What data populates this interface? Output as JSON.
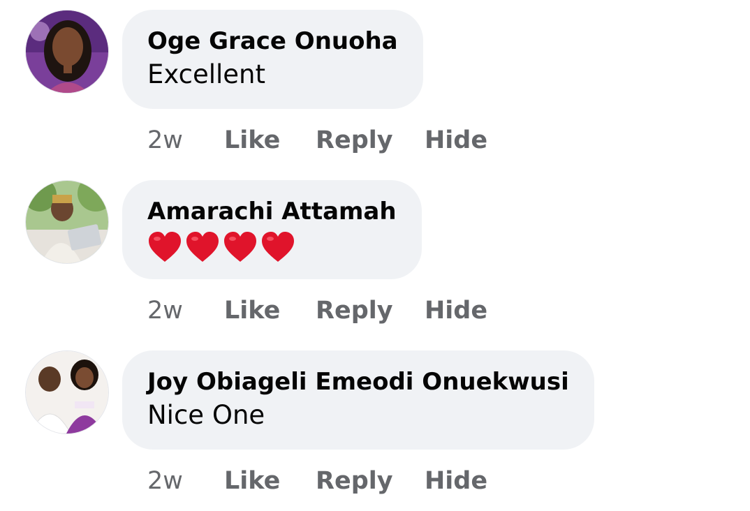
{
  "comments": [
    {
      "author": "Oge Grace Onuoha",
      "text": "Excellent",
      "time": "2w",
      "actions": [
        "Like",
        "Reply",
        "Hide"
      ]
    },
    {
      "author": "Amarachi Attamah",
      "text": "❤️❤️❤️❤️",
      "time": "2w",
      "actions": [
        "Like",
        "Reply",
        "Hide"
      ]
    },
    {
      "author": "Joy Obiageli Emeodi Onuekwusi",
      "text": "Nice One",
      "time": "2w",
      "actions": [
        "Like",
        "Reply",
        "Hide"
      ]
    }
  ],
  "colors": {
    "bubble": "#f0f2f5",
    "author_text": "#050505",
    "action_text": "#65676b",
    "heart": "#e0142b"
  },
  "icons": [
    "heart-emoji-icon"
  ]
}
